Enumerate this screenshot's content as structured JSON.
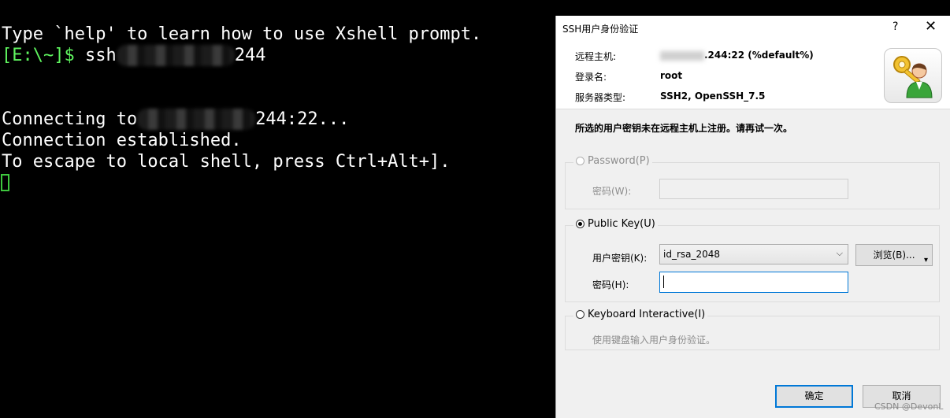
{
  "terminal": {
    "line1": "Type `help' to learn how to use Xshell prompt.",
    "prompt": "[E:\\~]$",
    "ssh_cmd": " ssh",
    "ssh_tail": "244",
    "connecting_prefix": "Connecting to",
    "connecting_suffix": "244:22...",
    "established": "Connection established.",
    "escape": "To escape to local shell, press Ctrl+Alt+].",
    "prompt_color": "#5ff55f"
  },
  "dialog": {
    "title": "SSH用户身份验证",
    "help": "?",
    "close": "✕",
    "remote_host_label": "远程主机:",
    "remote_host_value": ".244:22 (%default%)",
    "login_label": "登录名:",
    "login_value": "root",
    "server_type_label": "服务器类型:",
    "server_type_value": "SSH2, OpenSSH_7.5",
    "warning": "所选的用户密钥未在远程主机上注册。请再试一次。",
    "password_group": {
      "option": "Password(P)",
      "password_label": "密码(W):",
      "password_value": ""
    },
    "publickey_group": {
      "option": "Public Key(U)",
      "key_label": "用户密钥(K):",
      "key_value": "id_rsa_2048",
      "browse": "浏览(B)...",
      "passphrase_label": "密码(H):",
      "passphrase_value": ""
    },
    "keyboard_group": {
      "option": "Keyboard Interactive(I)",
      "description": "使用键盘输入用户身份验证。"
    },
    "ok": "确定",
    "cancel": "取消",
    "accent_color": "#0078d7"
  },
  "watermark": "CSDN @DevonL"
}
